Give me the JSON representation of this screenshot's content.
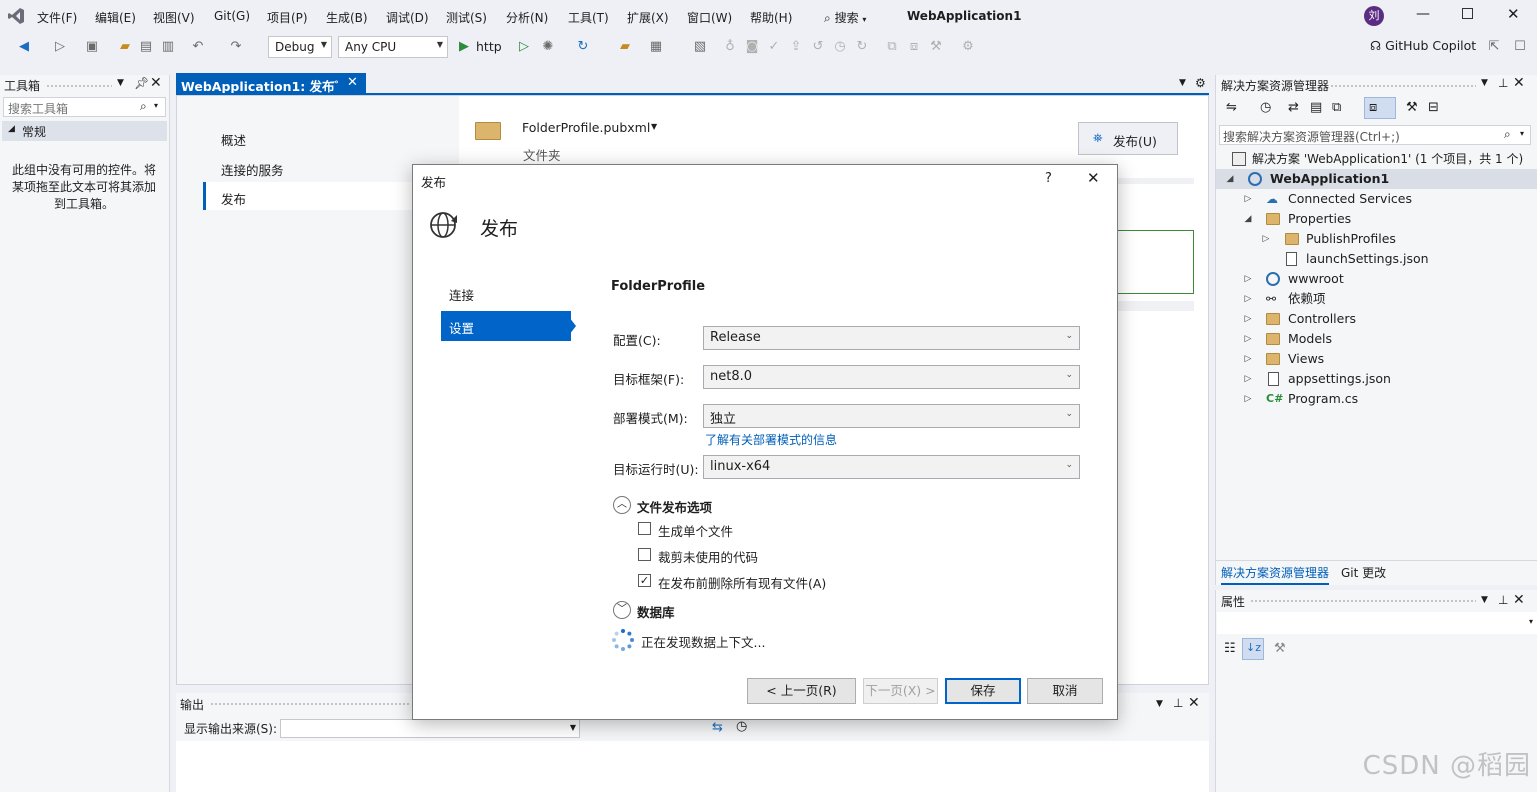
{
  "menubar": {
    "items": [
      "文件(F)",
      "编辑(E)",
      "视图(V)",
      "Git(G)",
      "项目(P)",
      "生成(B)",
      "调试(D)",
      "测试(S)",
      "分析(N)",
      "工具(T)",
      "扩展(X)",
      "窗口(W)",
      "帮助(H)"
    ],
    "search_label": "搜索",
    "solution_title": "WebApplication1",
    "avatar_text": "刘"
  },
  "toolbar": {
    "config_value": "Debug",
    "platform_value": "Any CPU",
    "run_label": "http",
    "copilot_label": "GitHub Copilot"
  },
  "toolbox": {
    "title": "工具箱",
    "search_placeholder": "搜索工具箱",
    "group": "常规",
    "empty_text": "此组中没有可用的控件。将某项拖至此文本可将其添加到工具箱。"
  },
  "editor": {
    "tab_title": "WebApplication1: 发布",
    "nav": [
      "概述",
      "连接的服务",
      "发布"
    ],
    "profile_name": "FolderProfile.pubxml",
    "profile_sub": "文件夹",
    "publish_button": "发布(U)"
  },
  "output": {
    "title": "输出",
    "source_label": "显示输出来源(S):"
  },
  "solution_explorer": {
    "title": "解决方案资源管理器",
    "search_placeholder": "搜索解决方案资源管理器(Ctrl+;)",
    "solution_line": "解决方案 'WebApplication1' (1 个项目，共 1 个)",
    "project": "WebApplication1",
    "items": [
      {
        "label": "Connected Services",
        "level": 1,
        "expand": "collapsed"
      },
      {
        "label": "Properties",
        "level": 1,
        "expand": "expanded"
      },
      {
        "label": "PublishProfiles",
        "level": 2,
        "expand": "collapsed"
      },
      {
        "label": "launchSettings.json",
        "level": 2,
        "expand": "none"
      },
      {
        "label": "wwwroot",
        "level": 1,
        "expand": "collapsed"
      },
      {
        "label": "依赖项",
        "level": 1,
        "expand": "collapsed"
      },
      {
        "label": "Controllers",
        "level": 1,
        "expand": "collapsed"
      },
      {
        "label": "Models",
        "level": 1,
        "expand": "collapsed"
      },
      {
        "label": "Views",
        "level": 1,
        "expand": "collapsed"
      },
      {
        "label": "appsettings.json",
        "level": 1,
        "expand": "collapsed"
      },
      {
        "label": "Program.cs",
        "level": 1,
        "expand": "collapsed"
      }
    ],
    "tabs": [
      "解决方案资源管理器",
      "Git 更改"
    ]
  },
  "properties": {
    "title": "属性"
  },
  "dialog": {
    "window_title": "发布",
    "help": "?",
    "heading": "发布",
    "steps": [
      "连接",
      "设置"
    ],
    "profile": "FolderProfile",
    "fields": [
      {
        "label": "配置(C):",
        "value": "Release"
      },
      {
        "label": "目标框架(F):",
        "value": "net8.0"
      },
      {
        "label": "部署模式(M):",
        "value": "独立"
      },
      {
        "label": "目标运行时(U):",
        "value": "linux-x64"
      }
    ],
    "deploy_link": "了解有关部署模式的信息",
    "file_options_title": "文件发布选项",
    "options": [
      {
        "label": "生成单个文件",
        "checked": false
      },
      {
        "label": "裁剪未使用的代码",
        "checked": false
      },
      {
        "label": "在发布前删除所有现有文件(A)",
        "checked": true
      }
    ],
    "database_title": "数据库",
    "loading_text": "正在发现数据上下文...",
    "buttons": {
      "prev": "< 上一页(R)",
      "next": "下一页(X) >",
      "save": "保存",
      "cancel": "取消"
    }
  },
  "watermark": "CSDN @稻园",
  "colors": {
    "accent": "#005fb8",
    "tab_active": "#005fb8",
    "selection": "#0064c8"
  }
}
